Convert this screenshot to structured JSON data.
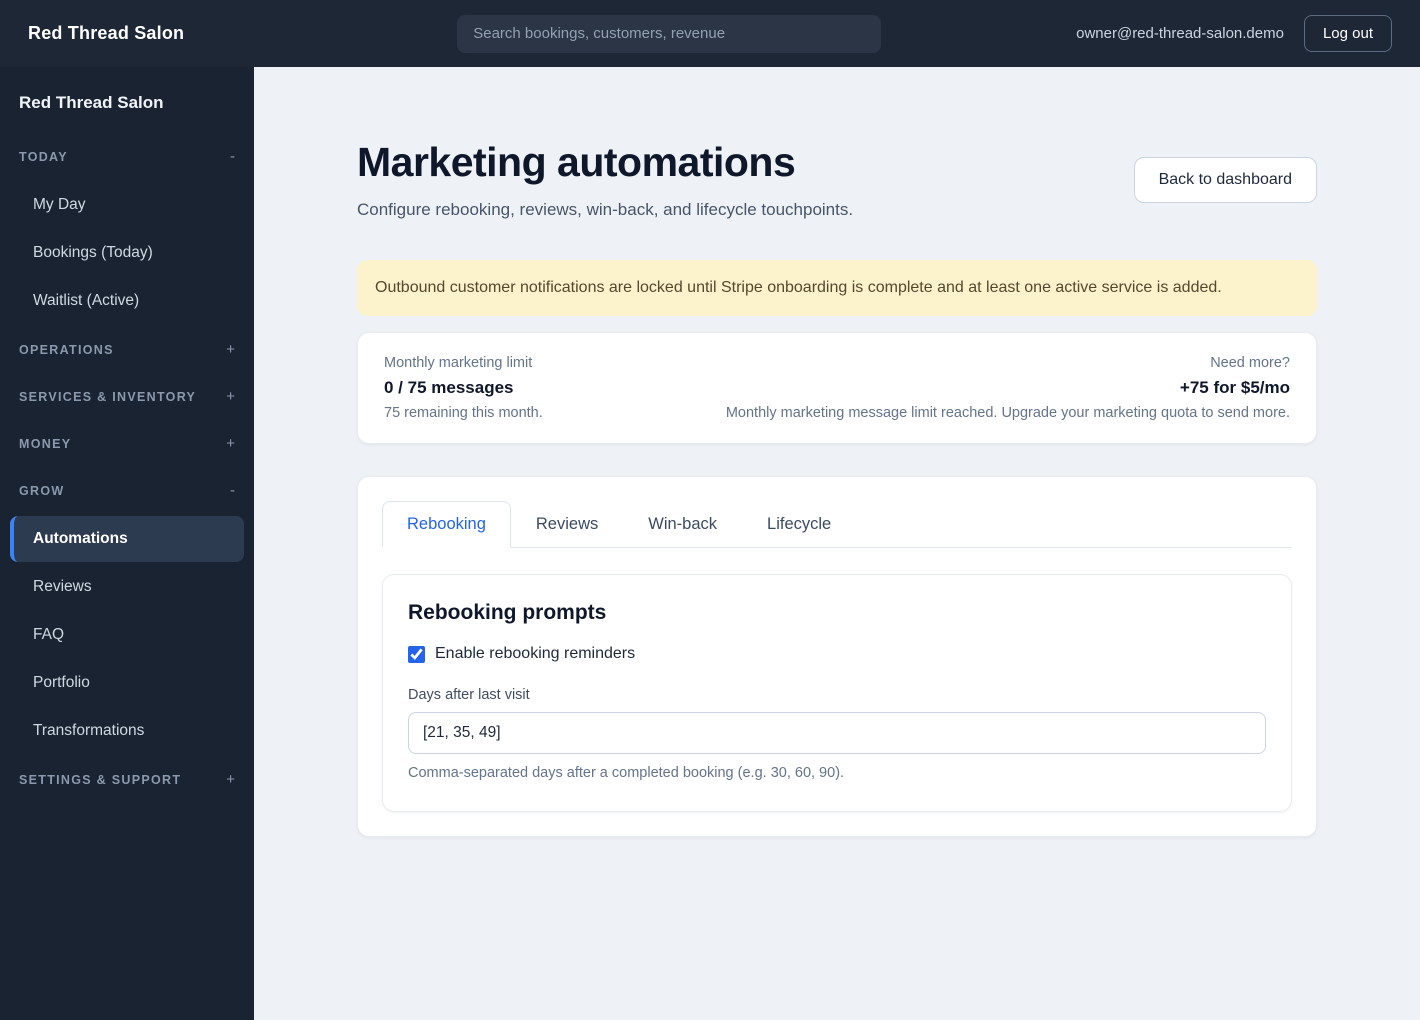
{
  "topbar": {
    "brand": "Red Thread Salon",
    "search_placeholder": "Search bookings, customers, revenue",
    "user_email": "owner@red-thread-salon.demo",
    "logout_label": "Log out"
  },
  "sidebar": {
    "title": "Red Thread Salon",
    "sections": [
      {
        "label": "TODAY",
        "toggle": "-",
        "items": [
          {
            "label": "My Day",
            "active": false
          },
          {
            "label": "Bookings (Today)",
            "active": false
          },
          {
            "label": "Waitlist (Active)",
            "active": false
          }
        ]
      },
      {
        "label": "OPERATIONS",
        "toggle": "+",
        "items": []
      },
      {
        "label": "SERVICES & INVENTORY",
        "toggle": "+",
        "items": []
      },
      {
        "label": "MONEY",
        "toggle": "+",
        "items": []
      },
      {
        "label": "GROW",
        "toggle": "-",
        "items": [
          {
            "label": "Automations",
            "active": true
          },
          {
            "label": "Reviews",
            "active": false
          },
          {
            "label": "FAQ",
            "active": false
          },
          {
            "label": "Portfolio",
            "active": false
          },
          {
            "label": "Transformations",
            "active": false
          }
        ]
      },
      {
        "label": "SETTINGS & SUPPORT",
        "toggle": "+",
        "items": []
      }
    ]
  },
  "main": {
    "title": "Marketing automations",
    "subtitle": "Configure rebooking, reviews, win-back, and lifecycle touchpoints.",
    "back_button": "Back to dashboard",
    "notice": "Outbound customer notifications are locked until Stripe onboarding is complete and at least one active service is added.",
    "quota": {
      "left_label": "Monthly marketing limit",
      "left_value": "0 / 75 messages",
      "left_sub": "75 remaining this month.",
      "right_label": "Need more?",
      "right_value": "+75 for $5/mo",
      "right_sub": "Monthly marketing message limit reached. Upgrade your marketing quota to send more."
    },
    "tabs": [
      {
        "label": "Rebooking",
        "active": true
      },
      {
        "label": "Reviews",
        "active": false
      },
      {
        "label": "Win-back",
        "active": false
      },
      {
        "label": "Lifecycle",
        "active": false
      }
    ],
    "panel": {
      "heading": "Rebooking prompts",
      "checkbox_label": "Enable rebooking reminders",
      "checkbox_checked": true,
      "field_label": "Days after last visit",
      "field_value": "[21, 35, 49]",
      "field_help": "Comma-separated days after a completed booking (e.g. 30, 60, 90)."
    }
  },
  "colors": {
    "accent": "#2563eb",
    "sidebar_bg": "#1a2331",
    "topbar_bg": "#1e2735",
    "notice_bg": "#fcf3cd",
    "main_bg": "#eef1f6"
  }
}
